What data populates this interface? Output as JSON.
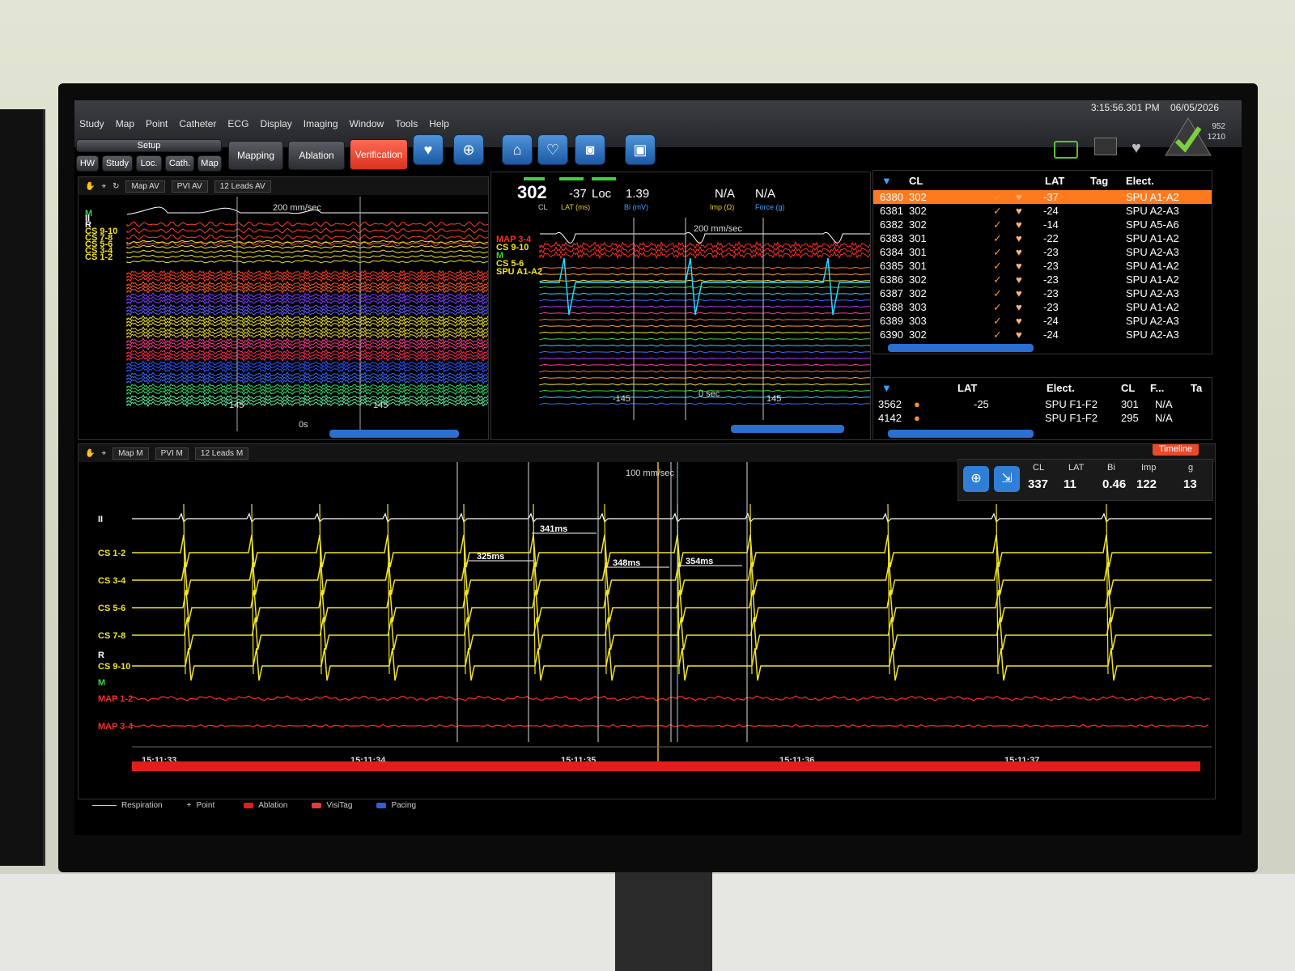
{
  "clock": {
    "time": "3:15:56.301 PM",
    "date": "06/05/2026"
  },
  "menu": [
    "Study",
    "Map",
    "Point",
    "Catheter",
    "ECG",
    "Display",
    "Imaging",
    "Window",
    "Tools",
    "Help"
  ],
  "toolbar": {
    "setup_label": "Setup",
    "setup_tabs": [
      "HW",
      "Study",
      "Loc.",
      "Cath.",
      "Map"
    ],
    "mapping": "Mapping",
    "ablation": "Ablation",
    "verification": "Verification"
  },
  "status": {
    "count_top": "952",
    "count_bottom": "1210"
  },
  "left_panel": {
    "map_select": "Map AV",
    "pvi_select": "PVI AV",
    "leads_select": "12 Leads AV",
    "speed": "200 mm/sec",
    "zero": "0s",
    "trace_labels": [
      "M",
      "II",
      "R",
      "CS 9-10",
      "CS 7-8",
      "CS 5-6",
      "CS 3-4",
      "CS 1-2"
    ],
    "marker_a": "145",
    "marker_b": "145"
  },
  "mid_panel": {
    "cl": "302",
    "cl_label": "CL",
    "lat": "-37",
    "lat_label": "LAT (ms)",
    "loc": "Loc",
    "bi": "1.39",
    "bi_label": "Bi (mV)",
    "imp": "N/A",
    "imp_label": "Imp (Ω)",
    "force": "N/A",
    "force_label": "Force (g)",
    "speed": "200 mm/sec",
    "trace_labels": [
      "MAP 3-4",
      "CS 9-10",
      "M",
      "CS 5-6",
      "SPU A1-A2"
    ],
    "m_neg": "-145",
    "zero": "0 sec",
    "m_pos": "145"
  },
  "points_table": {
    "headers": [
      "CL",
      "LAT",
      "Tag",
      "Elect."
    ],
    "rows": [
      {
        "id": "6380",
        "cl": "302",
        "lat": "-37",
        "elect": "SPU A1-A2",
        "selected": true
      },
      {
        "id": "6381",
        "cl": "302",
        "lat": "-24",
        "elect": "SPU A2-A3"
      },
      {
        "id": "6382",
        "cl": "302",
        "lat": "-14",
        "elect": "SPU A5-A6"
      },
      {
        "id": "6383",
        "cl": "301",
        "lat": "-22",
        "elect": "SPU A1-A2"
      },
      {
        "id": "6384",
        "cl": "301",
        "lat": "-23",
        "elect": "SPU A2-A3"
      },
      {
        "id": "6385",
        "cl": "301",
        "lat": "-23",
        "elect": "SPU A1-A2"
      },
      {
        "id": "6386",
        "cl": "302",
        "lat": "-23",
        "elect": "SPU A1-A2"
      },
      {
        "id": "6387",
        "cl": "302",
        "lat": "-23",
        "elect": "SPU A2-A3"
      },
      {
        "id": "6388",
        "cl": "303",
        "lat": "-23",
        "elect": "SPU A1-A2"
      },
      {
        "id": "6389",
        "cl": "303",
        "lat": "-24",
        "elect": "SPU A2-A3"
      },
      {
        "id": "6390",
        "cl": "302",
        "lat": "-24",
        "elect": "SPU A2-A3"
      }
    ]
  },
  "ablation_table": {
    "headers": [
      "LAT",
      "Elect.",
      "CL",
      "F...",
      "Ta"
    ],
    "rows": [
      {
        "id": "3562",
        "lat": "-25",
        "elect": "SPU F1-F2",
        "cl": "301",
        "f": "N/A"
      },
      {
        "id": "4142",
        "lat": "",
        "elect": "SPU F1-F2",
        "cl": "295",
        "f": "N/A"
      }
    ]
  },
  "bottom_panel": {
    "map_select": "Map M",
    "pvi_select": "PVI M",
    "leads_select": "12 Leads M",
    "speed": "100 mm/sec",
    "timeline": "Timeline",
    "readout": {
      "headers": [
        "CL",
        "LAT",
        "Bi",
        "Imp",
        "g"
      ],
      "values": [
        "337",
        "11",
        "0.46",
        "122",
        "13"
      ]
    },
    "trace_labels": [
      "II",
      "CS 1-2",
      "CS 3-4",
      "CS 5-6",
      "CS 7-8",
      "R",
      "CS 9-10",
      "M",
      "MAP 1-2",
      "MAP 3-4"
    ],
    "intervals": [
      "325ms",
      "341ms",
      "348ms",
      "354ms"
    ],
    "times": [
      "15:11:33",
      "15:11:34",
      "15:11:35",
      "15:11:36",
      "15:11:37"
    ]
  },
  "legend": [
    "Respiration",
    "Point",
    "Ablation",
    "VisiTag",
    "Pacing"
  ],
  "colors": {
    "verification": "#e8402b",
    "selected_row": "#ff7a1f",
    "cs_trace": "#f2e425",
    "map_trace": "#ff2b2b",
    "ecg_trace": "#ffffff",
    "scroll": "#2b6fd1"
  }
}
